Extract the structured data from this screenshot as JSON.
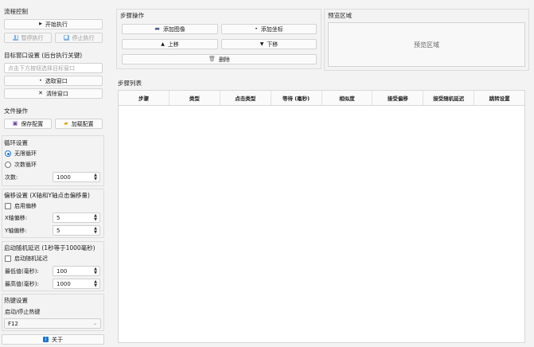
{
  "flow": {
    "title": "流程控制",
    "start": "开始执行",
    "pause": "暂停执行",
    "stop": "停止执行"
  },
  "target_window": {
    "title": "目标窗口设置 (后台执行关键)",
    "placeholder": "点击下方按钮选择目标窗口",
    "select": "选取窗口",
    "clear": "清除窗口"
  },
  "file_ops": {
    "title": "文件操作",
    "save": "保存配置",
    "load": "加载配置"
  },
  "loop": {
    "title": "循环设置",
    "infinite": "无限循环",
    "count_loop": "次数循环",
    "count_label": "次数:",
    "count_value": "1000"
  },
  "offset": {
    "title": "偏移设置 (X轴和Y轴点击偏移量)",
    "enable": "启用偏移",
    "x_label": "X轴偏移:",
    "x_value": "5",
    "y_label": "Y轴偏移:",
    "y_value": "5"
  },
  "random_delay": {
    "title": "启动随机延迟 (1秒等于1000毫秒)",
    "enable": "启动随机延迟",
    "min_label": "最低值(毫秒):",
    "min_value": "100",
    "max_label": "最高值(毫秒):",
    "max_value": "1000"
  },
  "hotkey": {
    "title": "热键设置",
    "label": "启动/停止热键",
    "value": "F12"
  },
  "about": "关于",
  "step_ops": {
    "title": "步骤操作",
    "add_image": "添加图像",
    "add_coord": "添加坐标",
    "move_up": "上移",
    "move_down": "下移",
    "delete": "删除"
  },
  "preview": {
    "title": "预览区域",
    "placeholder": "预览区域"
  },
  "step_list": {
    "title": "步骤列表",
    "columns": [
      "步骤",
      "类型",
      "点击类型",
      "等待 (毫秒)",
      "相似度",
      "接受偏移",
      "接受随机延迟",
      "跳转设置"
    ]
  },
  "colors": {
    "accent": "#1976d2",
    "background": "#f3f3f3"
  }
}
